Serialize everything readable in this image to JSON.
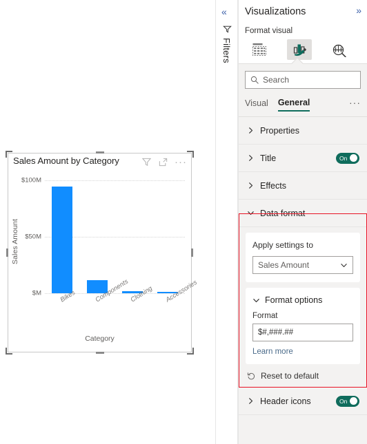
{
  "canvas": {
    "visual": {
      "title": "Sales Amount by Category",
      "header_icons": [
        {
          "name": "filter-icon",
          "label": "Filters"
        },
        {
          "name": "focus-mode-icon",
          "label": "Focus mode"
        },
        {
          "name": "more-options-icon",
          "label": "More options"
        }
      ]
    }
  },
  "chart_data": {
    "type": "bar",
    "title": "Sales Amount by Category",
    "xlabel": "Category",
    "ylabel": "Sales Amount",
    "categories": [
      "Bikes",
      "Components",
      "Clothing",
      "Accessories"
    ],
    "values": [
      94500000,
      11800000,
      2100000,
      1400000
    ],
    "ytick_labels": [
      "$100M",
      "$50M",
      "$M"
    ],
    "ytick_values": [
      100000000,
      50000000,
      0
    ],
    "ylim": [
      0,
      105000000
    ],
    "grid": true,
    "legend": "none",
    "series_color": "#118DFF"
  },
  "rail": {
    "collapse_label": "«",
    "filter_icon": "filter-icon",
    "label": "Filters"
  },
  "pane": {
    "title": "Visualizations",
    "expand_label": "»",
    "subtitle": "Format visual",
    "tabs": [
      {
        "name": "build-visual-tab",
        "icon": "fields-table-icon",
        "active": false
      },
      {
        "name": "format-visual-tab",
        "icon": "paintbrush-chart-icon",
        "active": true
      },
      {
        "name": "analytics-tab",
        "icon": "magnifier-chart-icon",
        "active": false
      }
    ],
    "search": {
      "placeholder": "Search",
      "value": "Search",
      "icon": "search-icon"
    },
    "sub_tabs": [
      {
        "label": "Visual",
        "active": false
      },
      {
        "label": "General",
        "active": true
      }
    ],
    "overflow_label": "···",
    "sections": [
      {
        "label": "Properties",
        "expanded": false,
        "toggle": null
      },
      {
        "label": "Title",
        "expanded": false,
        "toggle": "On"
      },
      {
        "label": "Effects",
        "expanded": false,
        "toggle": null
      }
    ],
    "data_format": {
      "label": "Data format",
      "expanded": true,
      "apply_settings_to": {
        "label": "Apply settings to",
        "value": "Sales Amount"
      },
      "format_options": {
        "label": "Format options",
        "expanded": true,
        "format_field_label": "Format",
        "format_value": "$#,###.##",
        "learn_more": "Learn more"
      }
    },
    "reset": {
      "label": "Reset to default",
      "icon": "undo-icon"
    },
    "header_icons_section": {
      "label": "Header icons",
      "toggle": "On"
    },
    "highlight_color": "#e81123",
    "accent_color": "#0f6c5c"
  }
}
